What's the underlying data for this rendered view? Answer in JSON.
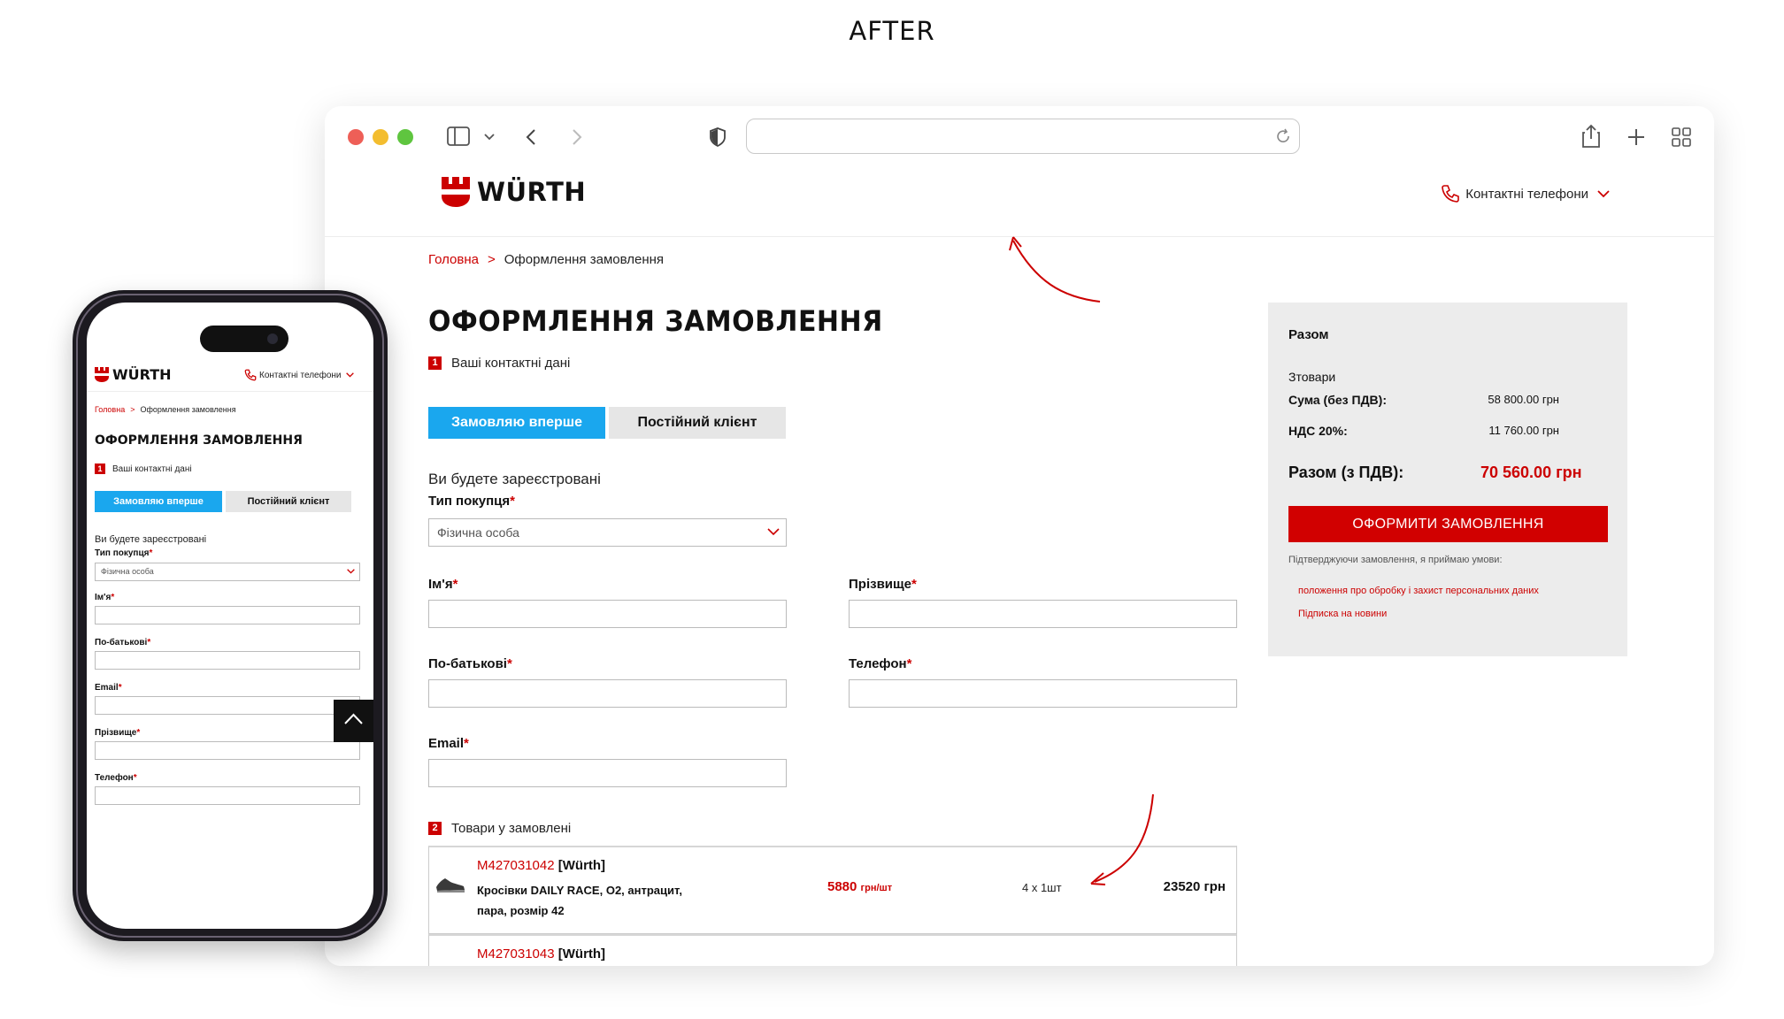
{
  "heading": "AFTER",
  "site": {
    "logo_text": "WÜRTH",
    "contact_label": "Контактні телефони"
  },
  "breadcrumb": {
    "home": "Головна",
    "separator": ">",
    "current": "Оформлення замовлення"
  },
  "page_title": "ОФОРМЛЕННЯ ЗАМОВЛЕННЯ",
  "section1": {
    "num": "1",
    "label": "Ваші контактні дані"
  },
  "tabs": {
    "first": "Замовляю вперше",
    "regular": "Постійний клієнт"
  },
  "register_note": "Ви будете зареєстровані",
  "form": {
    "purchase_type_label": "Тип покупця",
    "purchase_type_value": "Фізична особа",
    "first_name": "Ім'я",
    "last_name": "Прізвище",
    "patronymic": "По-батькові",
    "phone": "Телефон",
    "email": "Email",
    "required_mark": "*"
  },
  "section2": {
    "num": "2",
    "label": "Товари у замовлені"
  },
  "products": [
    {
      "code": "M427031042",
      "brand": "[Würth]",
      "name_line1": "Кросівки DAILY RACE, O2, антрацит,",
      "name_line2": "пара, розмір 42",
      "price": "5880",
      "price_unit": "грн/шт",
      "qty": "4 x 1шт",
      "total": "23520 грн"
    },
    {
      "code": "M427031043",
      "brand": "[Würth]"
    }
  ],
  "summary": {
    "title": "Разом",
    "items": "Зтовари",
    "sum_label": "Сума (без ПДВ):",
    "sum_value": "58 800.00 грн",
    "vat_label": "НДС 20%:",
    "vat_value": "11 760.00 грн",
    "total_label": "Разом (з ПДВ):",
    "total_value": "70 560.00 грн",
    "checkout_button": "ОФОРМИТИ ЗАМОВЛЕННЯ",
    "note": "Підтверджуючи замовлення, я приймаю умови:",
    "link1": "положення про обробку і захист персональних даних",
    "link2": "Підписка на новини"
  },
  "mobile": {
    "logo_text": "WÜRTH",
    "contact_label": "Контактні телефони",
    "breadcrumb_home": "Головна",
    "breadcrumb_sep": ">",
    "breadcrumb_current": "Оформлення замовлення",
    "title": "ОФОРМЛЕННЯ ЗАМОВЛЕННЯ",
    "section1_num": "1",
    "section1_label": "Ваші контактні дані",
    "tab_first": "Замовляю вперше",
    "tab_regular": "Постійний клієнт",
    "register_note": "Ви будете зареєстровані",
    "purchase_type_label": "Тип покупця",
    "purchase_type_value": "Фізична особа",
    "first_name": "Ім'я",
    "patronymic": "По-батькові",
    "email": "Email",
    "last_name": "Прізвище",
    "phone": "Телефон",
    "required_mark": "*"
  },
  "colors": {
    "brand_red": "#cc0000",
    "accent_blue": "#1aa7ee",
    "summary_bg": "#ececec",
    "button_red": "#d10000"
  }
}
